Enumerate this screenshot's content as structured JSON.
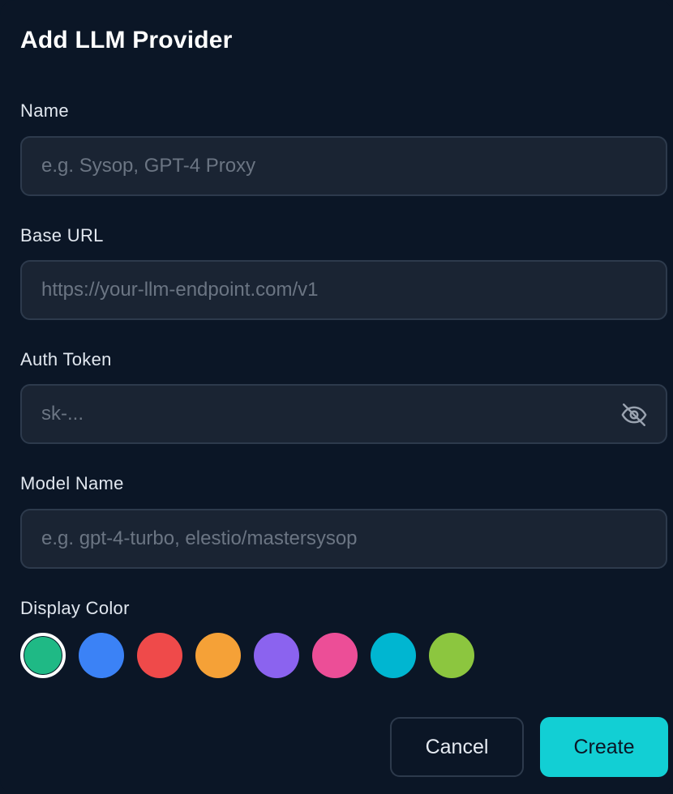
{
  "dialog": {
    "title": "Add LLM Provider"
  },
  "fields": {
    "name": {
      "label": "Name",
      "value": "",
      "placeholder": "e.g. Sysop, GPT-4 Proxy"
    },
    "base_url": {
      "label": "Base URL",
      "value": "",
      "placeholder": "https://your-llm-endpoint.com/v1"
    },
    "auth_token": {
      "label": "Auth Token",
      "value": "",
      "placeholder": "sk-...",
      "toggle_icon": "eye-off-icon"
    },
    "model_name": {
      "label": "Model Name",
      "value": "",
      "placeholder": "e.g. gpt-4-turbo, elestio/mastersysop"
    }
  },
  "display_color": {
    "label": "Display Color",
    "selected_index": 0,
    "options": [
      "#1fb985",
      "#3b82f6",
      "#ef4a4a",
      "#f5a137",
      "#8b63ef",
      "#ec4e97",
      "#00b6d1",
      "#8cc63f"
    ]
  },
  "actions": {
    "cancel_label": "Cancel",
    "create_label": "Create"
  },
  "colors": {
    "background": "#0b1626",
    "input_background": "#1a2433",
    "input_border": "#2d3a4c",
    "accent": "#12cfd4"
  }
}
